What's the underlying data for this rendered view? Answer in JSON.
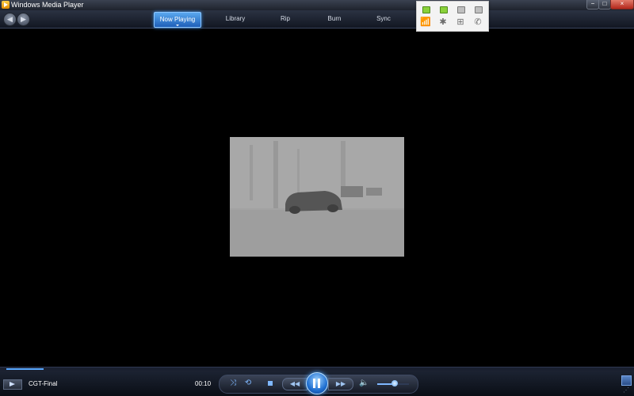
{
  "window": {
    "title": "Windows Media Player",
    "controls": {
      "minimize": "−",
      "maximize": "□",
      "close": "×"
    }
  },
  "nav": {
    "back_glyph": "◀",
    "forward_glyph": "▶",
    "tabs": [
      {
        "label": "Now Playing",
        "active": true
      },
      {
        "label": "Library",
        "active": false
      },
      {
        "label": "Rip",
        "active": false
      },
      {
        "label": "Burn",
        "active": false
      },
      {
        "label": "Sync",
        "active": false
      }
    ]
  },
  "network_widget": {
    "indicators": [
      {
        "icon": "wifi-icon",
        "glyph": "📶",
        "active": true
      },
      {
        "icon": "bluetooth-icon",
        "glyph": "✱",
        "active": true
      },
      {
        "icon": "lan-icon",
        "glyph": "⊞",
        "active": false
      },
      {
        "icon": "phone-icon",
        "glyph": "✆",
        "active": false
      }
    ]
  },
  "video": {
    "background_color": "#a2a2a2"
  },
  "player": {
    "track_title": "CGT-Final",
    "elapsed": "00:10",
    "progress": 0.06,
    "volume": 0.55,
    "icons": {
      "shuffle": "⤨",
      "repeat": "⟲",
      "prev": "◀◀",
      "next": "▶▶",
      "mute": "🔈",
      "resize": "⋰"
    }
  },
  "colors": {
    "accent": "#3b8de0",
    "seek_fill": "#59a8ff",
    "led_on": "#8ad13a"
  }
}
